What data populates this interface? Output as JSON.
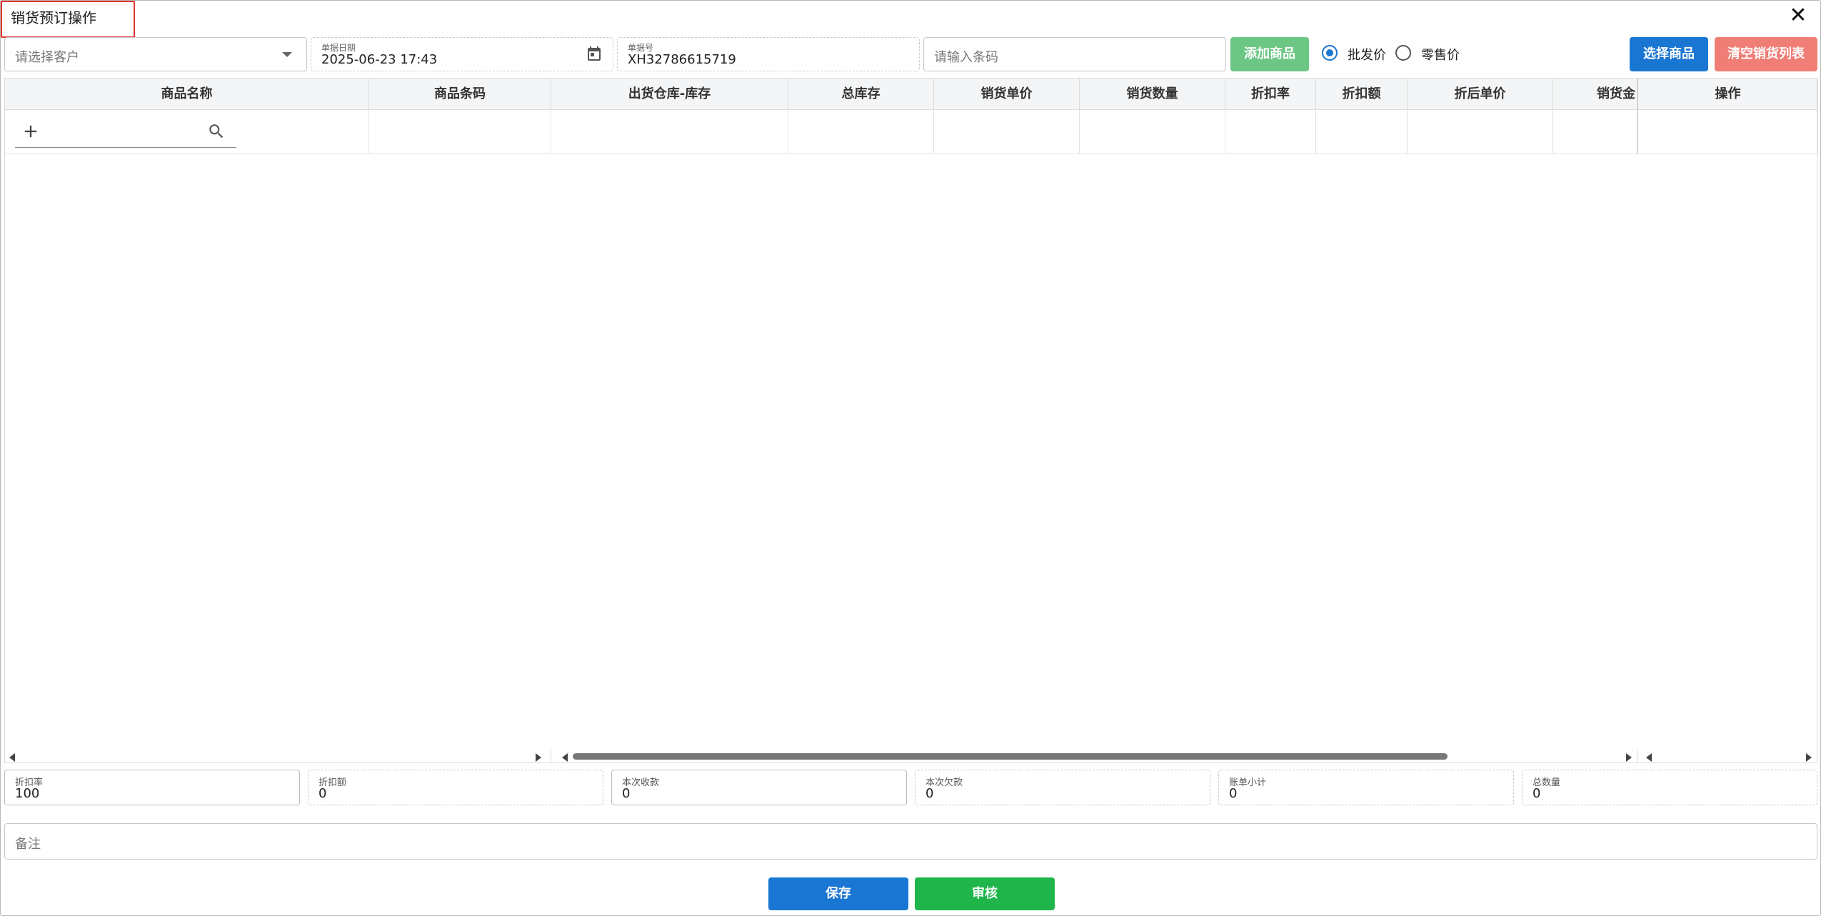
{
  "window": {
    "title": "销货预订操作",
    "close_icon": "close-icon"
  },
  "toolbar": {
    "customer_placeholder": "请选择客户",
    "date_label": "单据日期",
    "date_value": "2025-06-23 17:43",
    "order_no_label": "单据号",
    "order_no_value": "XH32786615719",
    "barcode_placeholder": "请输入条码",
    "add_product_label": "添加商品",
    "price_options": [
      {
        "label": "批发价",
        "selected": true
      },
      {
        "label": "零售价",
        "selected": false
      }
    ],
    "select_product_label": "选择商品",
    "clear_list_label": "清空销货列表"
  },
  "table": {
    "columns": [
      "商品名称",
      "商品条码",
      "出货仓库-库存",
      "总库存",
      "销货单价",
      "销货数量",
      "折扣率",
      "折扣额",
      "折后单价",
      "销货金",
      "操作"
    ],
    "rows": [
      {
        "product_name": "",
        "barcode": "",
        "warehouse_stock": "",
        "total_stock": "",
        "unit_price": "",
        "quantity": "",
        "discount_rate": "",
        "discount_amount": "",
        "discounted_price": "",
        "amount": ""
      }
    ]
  },
  "summary": {
    "fields": [
      {
        "label": "折扣率",
        "value": "100"
      },
      {
        "label": "折扣额",
        "value": "0"
      },
      {
        "label": "本次收款",
        "value": "0"
      },
      {
        "label": "本次欠款",
        "value": "0"
      },
      {
        "label": "账单小计",
        "value": "0"
      },
      {
        "label": "总数量",
        "value": "0"
      }
    ]
  },
  "remark_placeholder": "备注",
  "footer": {
    "save_label": "保存",
    "audit_label": "审核"
  },
  "colors": {
    "primary": "#1976d2",
    "success_light": "#6cc784",
    "danger_light": "#f07e76",
    "audit_green": "#1fb54a",
    "title_highlight": "#e0372f"
  }
}
